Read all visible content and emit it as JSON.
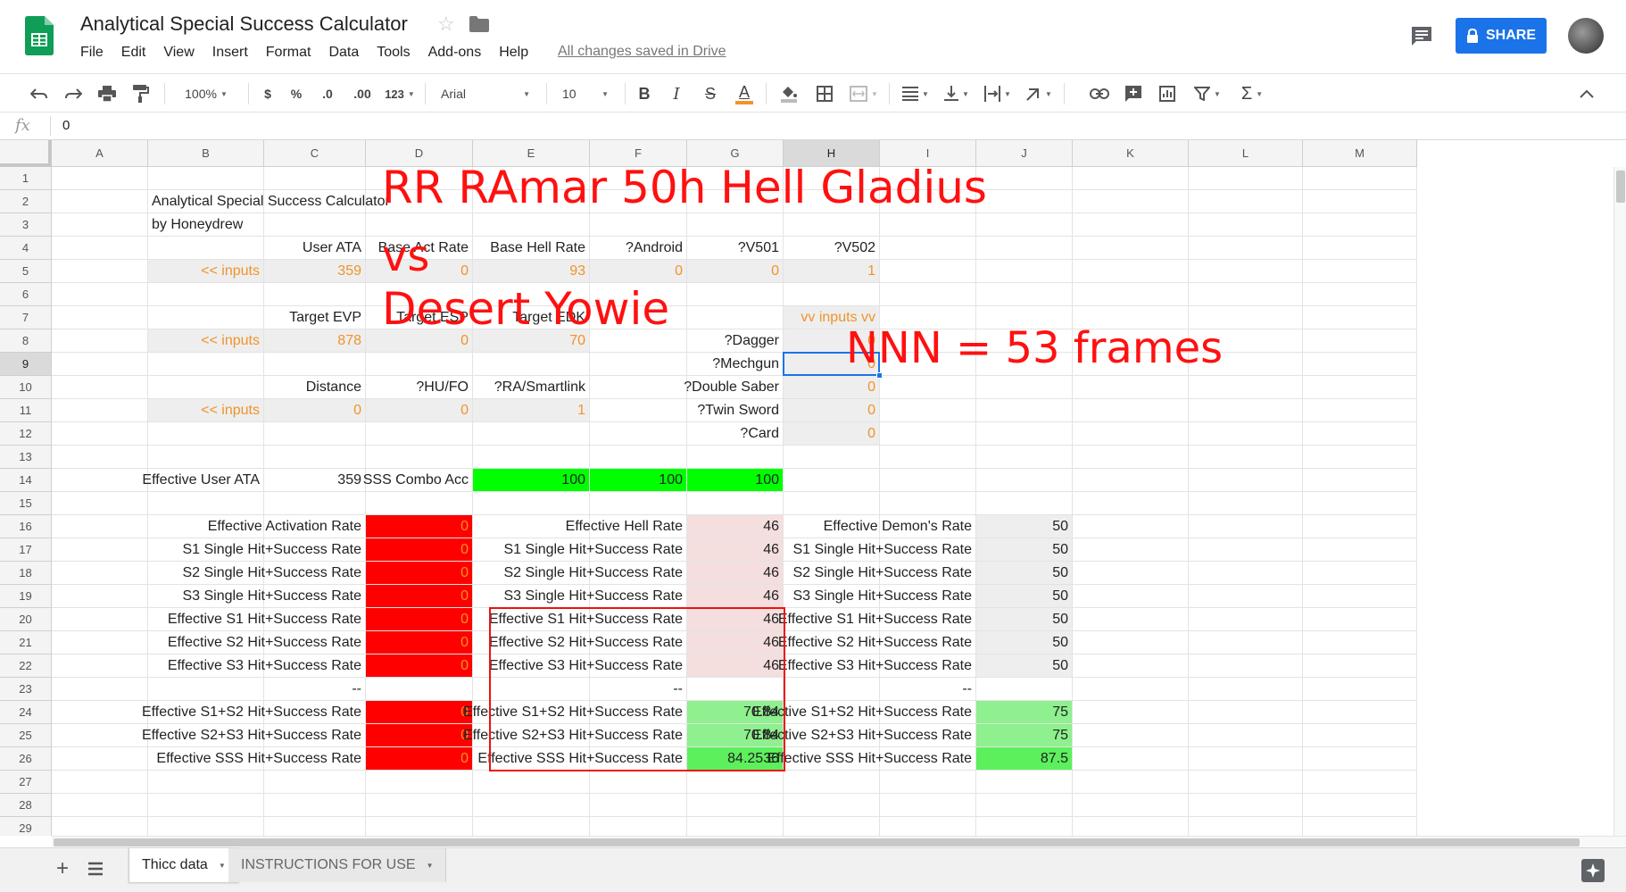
{
  "app": {
    "title": "Analytical Special Success Calculator",
    "saved_status": "All changes saved in Drive",
    "share_label": "SHARE",
    "menus": [
      "File",
      "Edit",
      "View",
      "Insert",
      "Format",
      "Data",
      "Tools",
      "Add-ons",
      "Help"
    ],
    "brand_color": "#1a73e8",
    "logo_color": "#0f9d58"
  },
  "toolbar": {
    "zoom": "100%",
    "currency": "$",
    "percent": "%",
    "decrease_decimal": ".0",
    "increase_decimal": ".00",
    "more_formats": "123",
    "font": "Arial",
    "font_size": "10",
    "bold": "B",
    "italic": "I",
    "strikethrough": "S",
    "text_color_glyph": "A",
    "sum_glyph": "Σ"
  },
  "formula_bar": {
    "fx": "fx",
    "value": "0"
  },
  "columns": [
    "A",
    "B",
    "C",
    "D",
    "E",
    "F",
    "G",
    "H",
    "I",
    "J",
    "K",
    "L",
    "M"
  ],
  "rows": [
    "1",
    "2",
    "3",
    "4",
    "5",
    "6",
    "7",
    "8",
    "9",
    "10",
    "11",
    "12",
    "13",
    "14",
    "15",
    "16",
    "17",
    "18",
    "19",
    "20",
    "21",
    "22",
    "23",
    "24",
    "25",
    "26",
    "27",
    "28",
    "29"
  ],
  "selected": {
    "column": "H",
    "row": "9"
  },
  "cells": {
    "B2": "Analytical Special Success Calculator",
    "B3": "by Honeydrew",
    "C4": "User ATA",
    "D4": "Base Act Rate",
    "E4": "Base Hell Rate",
    "F4": "Android?",
    "G4": "V501?",
    "H4": "V502?",
    "B5": "inputs >>",
    "C5": "359",
    "D5": "0",
    "E5": "93",
    "F5": "0",
    "G5": "0",
    "H5": "1",
    "C7": "Target EVP",
    "D7": "Target ESP",
    "E7": "Target EDK",
    "H7": "vv inputs vv",
    "B8": "inputs >>",
    "C8": "878",
    "D8": "0",
    "E8": "70",
    "G8": "Dagger?",
    "H8": "0",
    "G9": "Mechgun?",
    "H9": "0",
    "C10": "Distance",
    "D10": "HU/FO?",
    "E10": "RA/Smartlink?",
    "G10": "Double Saber?",
    "H10": "0",
    "B11": "inputs >>",
    "C11": "0",
    "D11": "0",
    "E11": "1",
    "G11": "Twin Sword?",
    "H11": "0",
    "G12": "Card?",
    "H12": "0",
    "B14": "Effective User ATA",
    "C14": "359",
    "D14": "SSS Combo Acc",
    "E14": "100",
    "F14": "100",
    "G14": "100",
    "C16": "Effective Activation Rate",
    "D16": "0",
    "F16": "Effective Hell Rate",
    "G16": "46",
    "I16": "Effective Demon's Rate",
    "J16": "50",
    "C17": "S1 Single Hit+Success Rate",
    "D17": "0",
    "F17": "S1 Single Hit+Success Rate",
    "G17": "46",
    "I17": "S1 Single Hit+Success Rate",
    "J17": "50",
    "C18": "S2 Single Hit+Success Rate",
    "D18": "0",
    "F18": "S2 Single Hit+Success Rate",
    "G18": "46",
    "I18": "S2 Single Hit+Success Rate",
    "J18": "50",
    "C19": "S3 Single Hit+Success Rate",
    "D19": "0",
    "F19": "S3 Single Hit+Success Rate",
    "G19": "46",
    "I19": "S3 Single Hit+Success Rate",
    "J19": "50",
    "C20": "Effective S1 Hit+Success Rate",
    "D20": "0",
    "F20": "Effective S1 Hit+Success Rate",
    "G20": "46",
    "I20": "Effective S1 Hit+Success Rate",
    "J20": "50",
    "C21": "Effective S2 Hit+Success Rate",
    "D21": "0",
    "F21": "Effective S2 Hit+Success Rate",
    "G21": "46",
    "I21": "Effective S2 Hit+Success Rate",
    "J21": "50",
    "C22": "Effective S3 Hit+Success Rate",
    "D22": "0",
    "F22": "Effective S3 Hit+Success Rate",
    "G22": "46",
    "I22": "Effective S3 Hit+Success Rate",
    "J22": "50",
    "C23": "--",
    "F23": "--",
    "I23": "--",
    "C24": "Effective S1+S2 Hit+Success Rate",
    "D24": "0",
    "F24": "Effective S1+S2 Hit+Success Rate",
    "G24": "70.84",
    "I24": "Effective S1+S2 Hit+Success Rate",
    "J24": "75",
    "C25": "Effective S2+S3 Hit+Success Rate",
    "D25": "0",
    "F25": "Effective S2+S3 Hit+Success Rate",
    "G25": "70.84",
    "I25": "Effective S2+S3 Hit+Success Rate",
    "J25": "75",
    "C26": "Effective SSS Hit+Success Rate",
    "D26": "0",
    "F26": "Effective SSS Hit+Success Rate",
    "G26": "84.2536",
    "I26": "Effective SSS Hit+Success Rate",
    "J26": "87.5"
  },
  "annotations": {
    "title_line": "RR RAmar 50h Hell Gladius",
    "vs": "vs",
    "target": "Desert Yowie",
    "nnn": "NNN = 53 frames",
    "color": "#ff1010"
  },
  "colors": {
    "input_text": "#f0932b",
    "input_bg": "#eeeeee",
    "zero_red": "#ff0000",
    "hell_pink": "#f4dede",
    "combo_green": "#00ff00",
    "pair_green": "#8ef08e",
    "sss_green": "#5cf05c"
  },
  "sheets": {
    "active": "Thicc data",
    "other": "INSTRUCTIONS FOR USE"
  }
}
